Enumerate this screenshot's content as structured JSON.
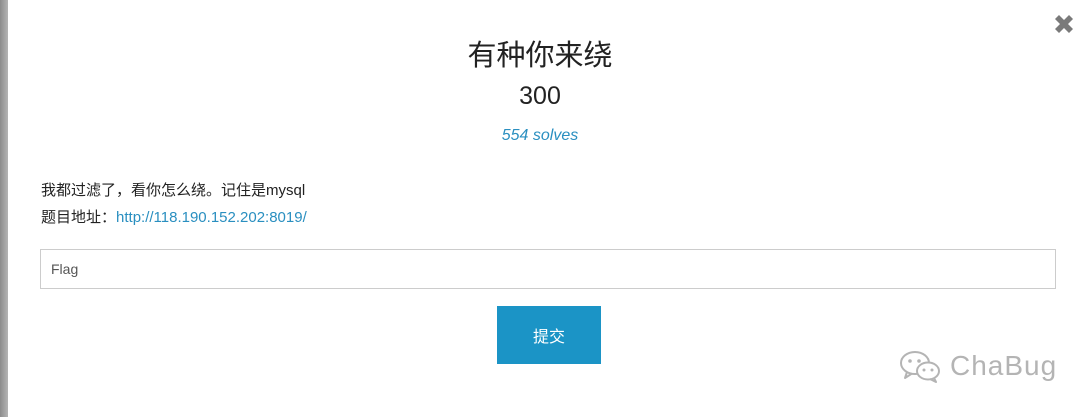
{
  "modal": {
    "title": "有种你来绕",
    "points": "300",
    "solves": "554 solves",
    "description": {
      "line1": "我都过滤了，看你怎么绕。记住是mysql",
      "address_label": "题目地址：",
      "address_link": "http://118.190.152.202:8019/"
    },
    "flag_input": {
      "placeholder": "Flag",
      "value": ""
    },
    "submit_label": "提交",
    "close_icon": "close-icon"
  },
  "watermark": {
    "text": "ChaBug",
    "icon": "wechat-icon"
  },
  "colors": {
    "accent": "#1b94c6",
    "link": "#2a8fc0",
    "text": "#222222",
    "close_icon": "#7a7a7a"
  }
}
